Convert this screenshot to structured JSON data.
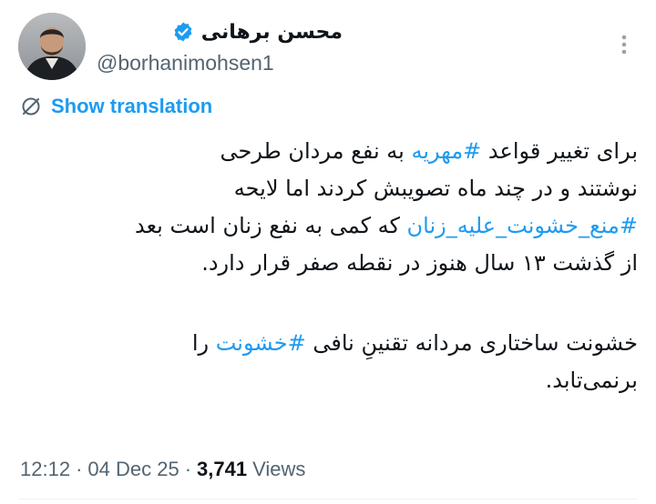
{
  "author": {
    "display_name": "محسن برهانی",
    "handle": "@borhanimohsen1",
    "verified": true
  },
  "actions": {
    "more_icon": "more-vertical-icon",
    "translation_label": "Show translation",
    "translation_icon": "translate-icon"
  },
  "tweet": {
    "lines": [
      {
        "parts": [
          "برای تغییر قواعد ",
          "#مهریه",
          " به نفع مردان طرحی"
        ]
      },
      {
        "parts": [
          "نوشتند و در چند ماه تصویبش کردند اما لایحه"
        ]
      },
      {
        "parts": [
          "#منع_خشونت_علیه_زنان",
          " که کمی به نفع زنان است بعد"
        ]
      },
      {
        "parts": [
          "از گذشت ۱۳ سال هنوز در نقطه صفر قرار دارد."
        ]
      },
      {
        "parts": [
          "خشونت ساختاری مردانه تقنینِ نافی ",
          "#خشونت",
          " را"
        ]
      },
      {
        "parts": [
          "برنمی‌تابد."
        ]
      }
    ],
    "hashtags": [
      "#مهریه",
      "#منع_خشونت_علیه_زنان",
      "#خشونت"
    ]
  },
  "meta": {
    "time": "12:12",
    "separator": "·",
    "date": "04 Dec 25",
    "views_count": "3,741",
    "views_label": "Views"
  },
  "colors": {
    "accent": "#1d9bf0",
    "text": "#0f1419",
    "secondary": "#536471"
  }
}
